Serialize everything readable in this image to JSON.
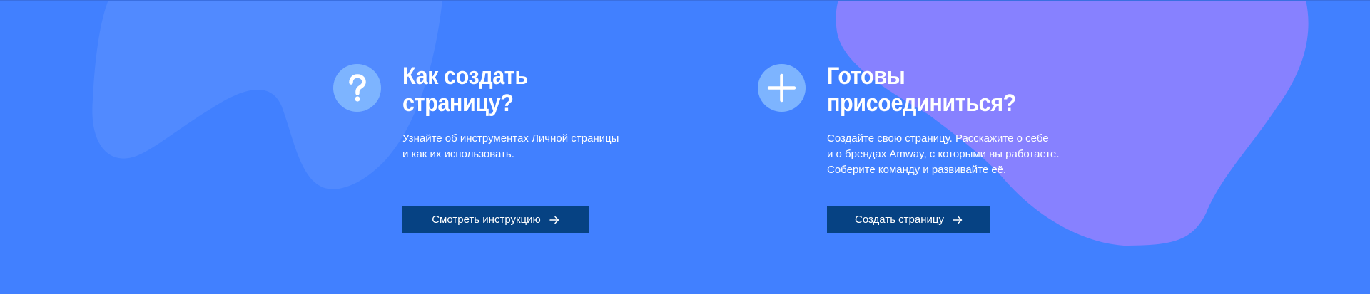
{
  "colors": {
    "background": "#4180ff",
    "blob_left": "#518aff",
    "blob_right": "#8781ff",
    "icon_circle": "#7db4ff",
    "button": "#064283",
    "text": "#ffffff"
  },
  "cards": [
    {
      "icon": "question-icon",
      "title_lines": [
        "Как создать",
        "страницу?"
      ],
      "description_lines": [
        "Узнайте об инструментах Личной страницы",
        "и как их использовать."
      ],
      "button_label": "Смотреть инструкцию",
      "button_icon": "arrow-right-icon"
    },
    {
      "icon": "plus-icon",
      "title_lines": [
        "Готовы",
        "присоединиться?"
      ],
      "description_lines": [
        "Создайте свою страницу. Расскажите о себе",
        "и о брендах Amway, с которыми вы работаете.",
        "Соберите команду и развивайте её."
      ],
      "button_label": "Создать страницу",
      "button_icon": "arrow-right-icon"
    }
  ]
}
